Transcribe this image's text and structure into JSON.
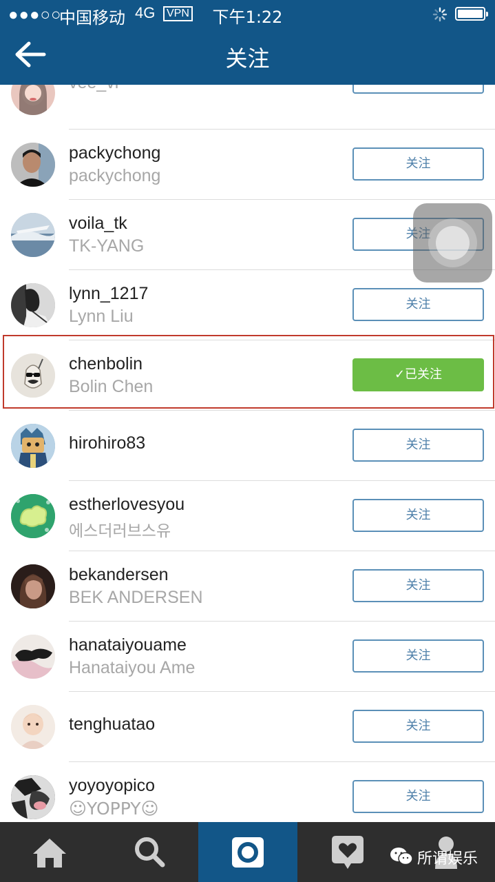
{
  "status_bar": {
    "signal": "●●●○○",
    "carrier": "中国移动",
    "network": "4G",
    "vpn": "VPN",
    "time": "下午1:22"
  },
  "nav": {
    "title": "关注"
  },
  "users": [
    {
      "username": "vee_vl",
      "fullname": "vee_vl",
      "button": "关注",
      "following": false
    },
    {
      "username": "packychong",
      "fullname": "packychong",
      "button": "关注",
      "following": false
    },
    {
      "username": "voila_tk",
      "fullname": "TK-YANG",
      "button": "关注",
      "following": false
    },
    {
      "username": "lynn_1217",
      "fullname": "Lynn Liu",
      "button": "关注",
      "following": false
    },
    {
      "username": "chenbolin",
      "fullname": "Bolin Chen",
      "button": "✓已关注",
      "following": true
    },
    {
      "username": "hirohiro83",
      "fullname": "",
      "button": "关注",
      "following": false
    },
    {
      "username": "estherlovesyou",
      "fullname": "에스더러브스유",
      "button": "关注",
      "following": false
    },
    {
      "username": "bekandersen",
      "fullname": "BEK ANDERSEN",
      "button": "关注",
      "following": false
    },
    {
      "username": "hanataiyouame",
      "fullname": "Hanataiyou Ame",
      "button": "关注",
      "following": false
    },
    {
      "username": "tenghuatao",
      "fullname": "",
      "button": "关注",
      "following": false
    },
    {
      "username": "yoyoyopico",
      "fullname": "☺YOPPY☺",
      "button": "关注",
      "following": false
    }
  ],
  "tabbar": {
    "items": [
      "home-icon",
      "search-icon",
      "camera-icon",
      "activity-icon",
      "profile-icon"
    ],
    "active": "camera-icon"
  },
  "watermark": {
    "text": "所谓娱乐"
  },
  "colors": {
    "header": "#125688",
    "follow_border": "#5a8fb7",
    "following_bg": "#6cbd45",
    "highlight_box": "#c0392b",
    "tabbar_bg": "#2e2e2e"
  }
}
